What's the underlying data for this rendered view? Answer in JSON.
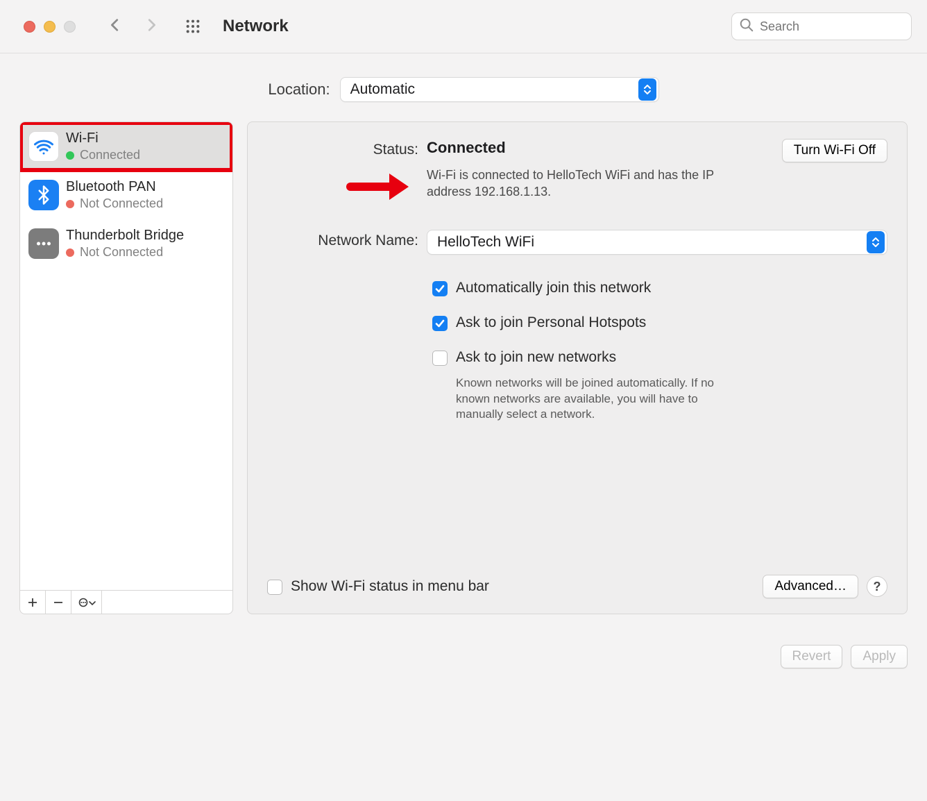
{
  "toolbar": {
    "title": "Network",
    "search_placeholder": "Search"
  },
  "location": {
    "label": "Location:",
    "value": "Automatic"
  },
  "sidebar": {
    "services": [
      {
        "name": "Wi-Fi",
        "status": "Connected",
        "status_color": "green",
        "selected": true
      },
      {
        "name": "Bluetooth PAN",
        "status": "Not Connected",
        "status_color": "red",
        "selected": false
      },
      {
        "name": "Thunderbolt Bridge",
        "status": "Not Connected",
        "status_color": "red",
        "selected": false
      }
    ]
  },
  "main": {
    "status_label": "Status:",
    "status_value": "Connected",
    "wifi_off_button": "Turn Wi-Fi Off",
    "status_desc": "Wi-Fi is connected to HelloTech WiFi and has the IP address 192.168.1.13.",
    "network_name_label": "Network Name:",
    "network_name_value": "HelloTech WiFi",
    "checkboxes": [
      {
        "label": "Automatically join this network",
        "checked": true
      },
      {
        "label": "Ask to join Personal Hotspots",
        "checked": true
      },
      {
        "label": "Ask to join new networks",
        "checked": false,
        "note": "Known networks will be joined automatically. If no known networks are available, you will have to manually select a network."
      }
    ],
    "show_menu_bar": {
      "label": "Show Wi-Fi status in menu bar",
      "checked": false
    },
    "advanced_button": "Advanced…"
  },
  "footer": {
    "revert": "Revert",
    "apply": "Apply"
  }
}
